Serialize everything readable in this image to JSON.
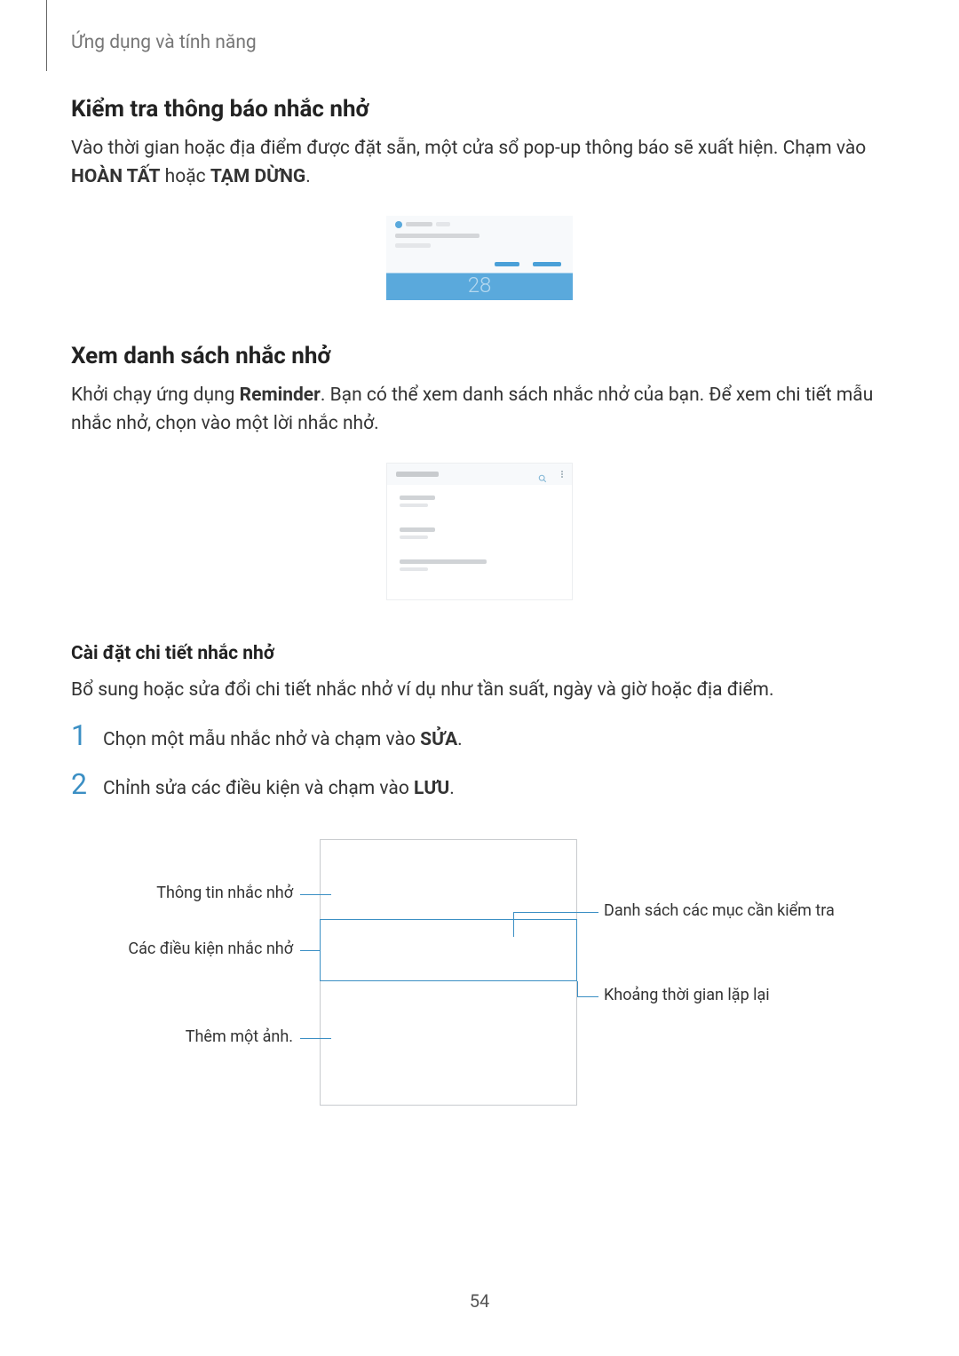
{
  "header": {
    "section_title": "Ứng dụng và tính năng"
  },
  "section1": {
    "heading": "Kiểm tra thông báo nhắc nhở",
    "para_a": "Vào thời gian hoặc địa điểm được đặt sẵn, một cửa sổ pop-up thông báo sẽ xuất hiện. Chạm vào ",
    "bold1": "HOÀN TẤT",
    "mid": " hoặc ",
    "bold2": "TẠM DỪNG",
    "end": ".",
    "popup_number": "28"
  },
  "section2": {
    "heading": "Xem danh sách nhắc nhở",
    "para_a": "Khởi chạy ứng dụng ",
    "bold1": "Reminder",
    "para_b": ". Bạn có thể xem danh sách nhắc nhở của bạn. Để xem chi tiết mẫu nhắc nhở, chọn vào một lời nhắc nhở."
  },
  "section3": {
    "heading": "Cài đặt chi tiết nhắc nhở",
    "para": "Bổ sung hoặc sửa đổi chi tiết nhắc nhở ví dụ như tần suất, ngày và giờ hoặc địa điểm.",
    "step1_num": "1",
    "step1_a": "Chọn một mẫu nhắc nhở và chạm vào ",
    "step1_b": "SỬA",
    "step1_c": ".",
    "step2_num": "2",
    "step2_a": "Chỉnh sửa các điều kiện và chạm vào ",
    "step2_b": "LƯU",
    "step2_c": "."
  },
  "callouts": {
    "left1": "Thông tin nhắc nhở",
    "left2": "Các điều kiện nhắc nhở",
    "left3": "Thêm một ảnh.",
    "right1": "Danh sách các mục cần kiểm tra",
    "right2": "Khoảng thời gian lặp lại"
  },
  "page_number": "54"
}
